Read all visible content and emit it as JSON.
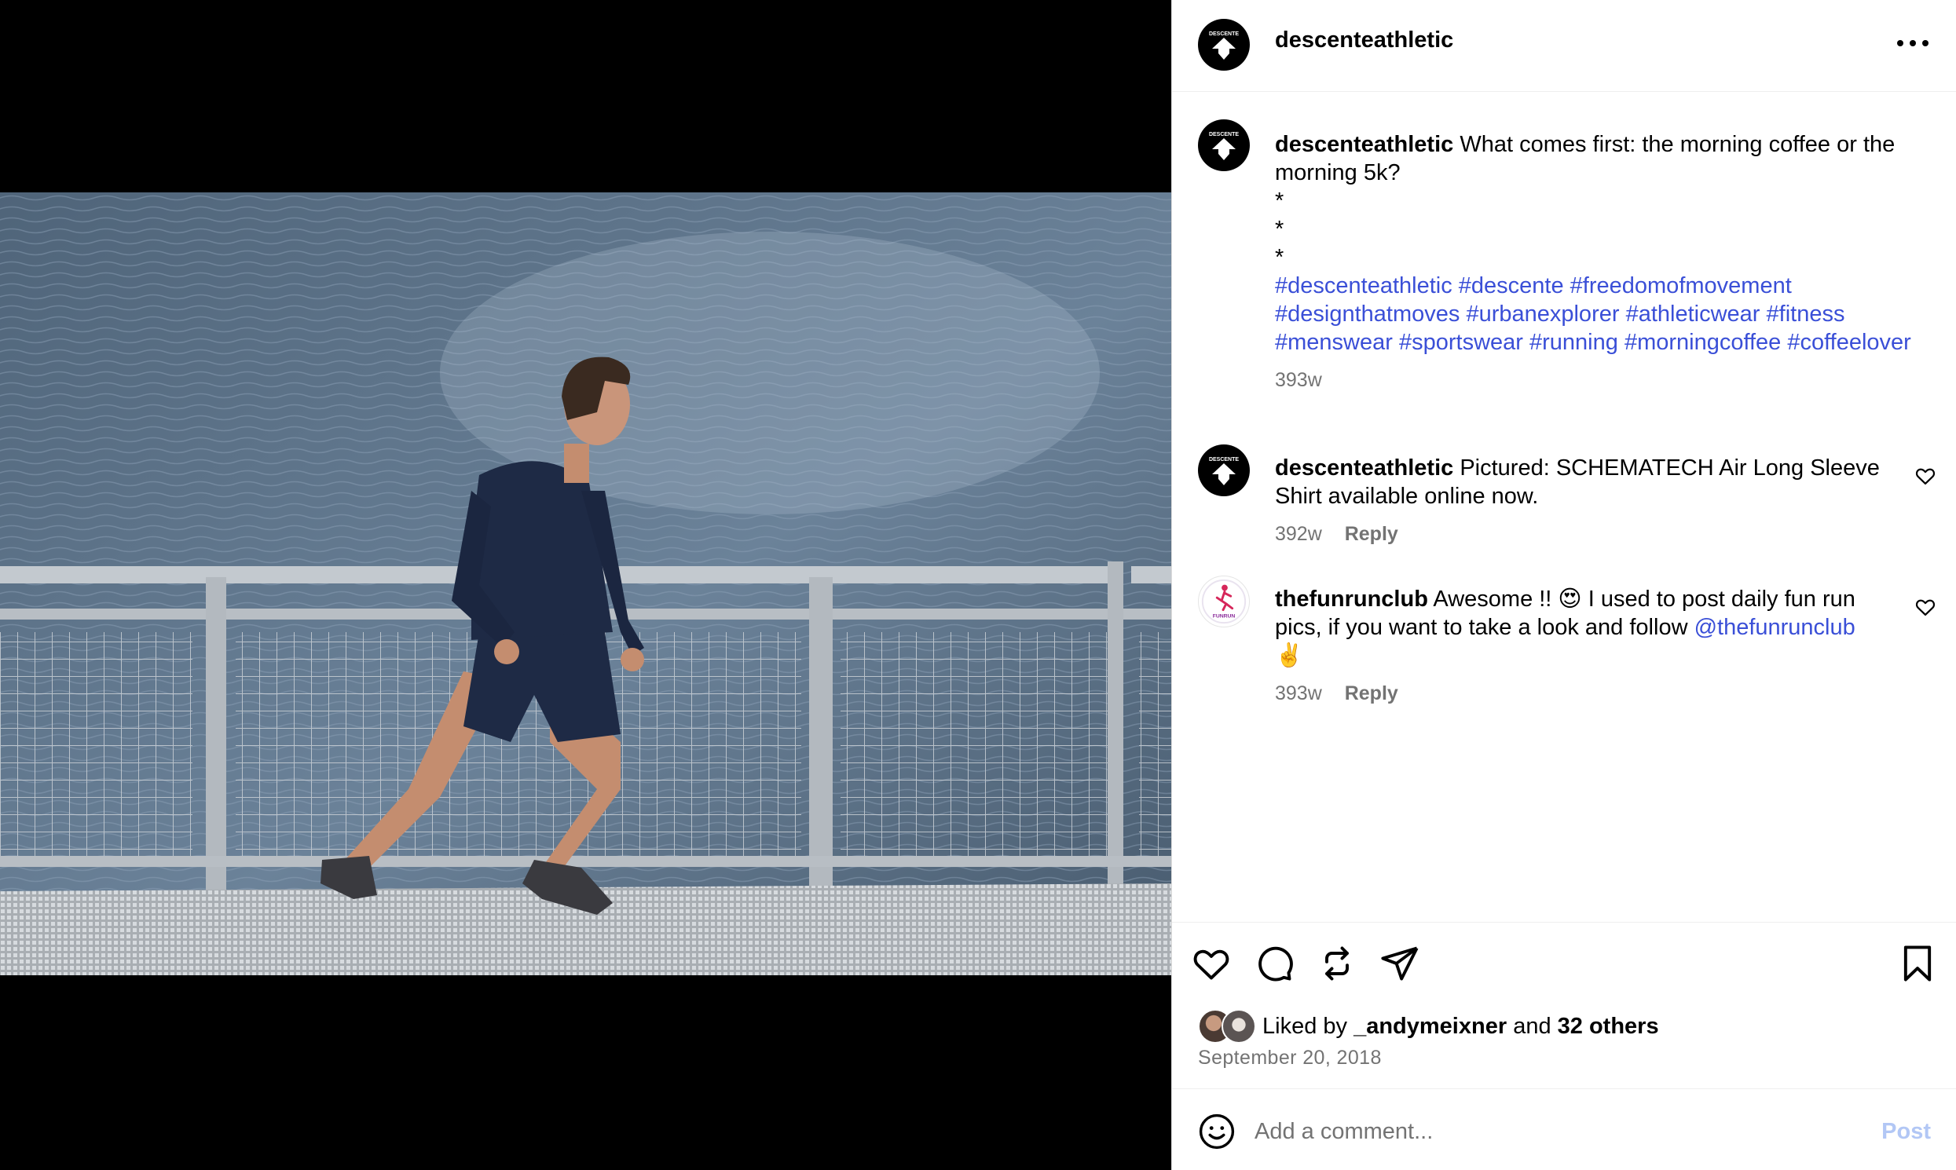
{
  "post": {
    "username": "descenteathletic",
    "brand_mark": "DESCENTE",
    "more_icon": "more-horizontal-icon"
  },
  "caption": {
    "username": "descenteathletic",
    "text": "What comes first: the morning coffee or the morning 5k?",
    "stars": [
      "*",
      "*",
      "*"
    ],
    "hashtags": [
      "#descenteathletic",
      "#descente",
      "#freedomofmovement",
      "#designthatmoves",
      "#urbanexplorer",
      "#athleticwear",
      "#fitness",
      "#menswear",
      "#sportswear",
      "#running",
      "#morningcoffee",
      "#coffeelover"
    ],
    "age": "393w"
  },
  "comments": [
    {
      "username": "descenteathletic",
      "text": "Pictured: SCHEMATECH Air Long Sleeve Shirt available online now.",
      "mention": "",
      "trailing": "",
      "age": "392w",
      "reply_label": "Reply"
    },
    {
      "username": "thefunrunclub",
      "text": "Awesome !! 😍 I used to post daily fun run pics, if you want to take a look and follow ",
      "mention": "@thefunrunclub",
      "trailing": " ✌️",
      "age": "393w",
      "reply_label": "Reply",
      "avatar_label": "FUNRUN"
    }
  ],
  "actions": {
    "icons": [
      "heart-icon",
      "comment-icon",
      "repost-icon",
      "share-icon",
      "bookmark-icon"
    ]
  },
  "likes": {
    "prefix": "Liked by",
    "user": "_andymeixner",
    "joiner": "and",
    "others": "32 others"
  },
  "date": "September 20, 2018",
  "composer": {
    "placeholder": "Add a comment...",
    "post_label": "Post"
  },
  "colors": {
    "link": "#3a4fd7",
    "muted": "#737373",
    "post_disabled": "#b2c7f5"
  }
}
